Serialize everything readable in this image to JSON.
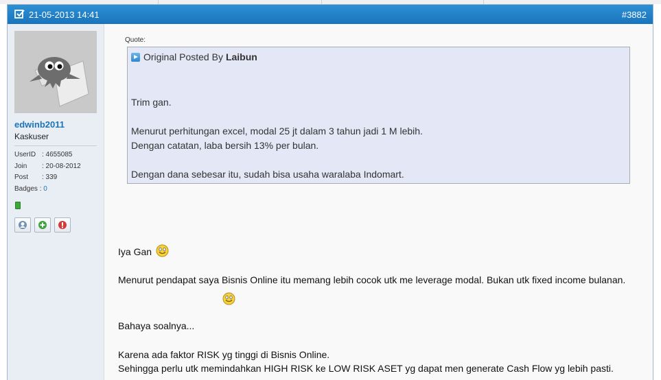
{
  "post": {
    "date": "21-05-2013 14:41",
    "number": "#3882"
  },
  "user": {
    "name": "edwinb2011",
    "title": "Kaskuser",
    "stats": [
      {
        "key": "UserID",
        "value": ": 4655085"
      },
      {
        "key": "Join",
        "value": ": 20-08-2012"
      },
      {
        "key": "Post",
        "value": ": 339"
      }
    ],
    "badges_label": "Badges :",
    "badges_value": "0"
  },
  "quote": {
    "label": "Quote:",
    "prefix": "Original Posted By",
    "author": "Laibun",
    "lines": [
      "Trim gan.",
      "Menurut perhitungan excel, modal 25 jt dalam 3 tahun jadi 1 M lebih.",
      "Dengan catatan, laba bersih 13% per bulan.",
      "Dengan dana sebesar itu, sudah bisa usaha waralaba Indomart."
    ]
  },
  "body": {
    "lines": [
      "Iya Gan",
      "Menurut pendapat saya Bisnis Online itu memang lebih cocok utk me leverage modal. Bukan utk fixed income bulanan.",
      "Bahaya soalnya...",
      "Karena ada faktor RISK yg tinggi di Bisnis Online.",
      "Sehingga perlu utk memindahkan HIGH RISK ke LOW RISK ASET yg dapat men generate Cash Flow yg lebih pasti."
    ]
  },
  "icons": {
    "header": "checkbox-icon",
    "quote": "play-icon",
    "smiley": "smiley-icon",
    "user_buttons": [
      "profile-icon",
      "add-icon",
      "report-icon"
    ]
  },
  "colors": {
    "header_blue": "#1a74bc",
    "username_blue": "#1b74b8",
    "quote_bg": "#e3e7f6",
    "online_green": "#3aa83a"
  }
}
